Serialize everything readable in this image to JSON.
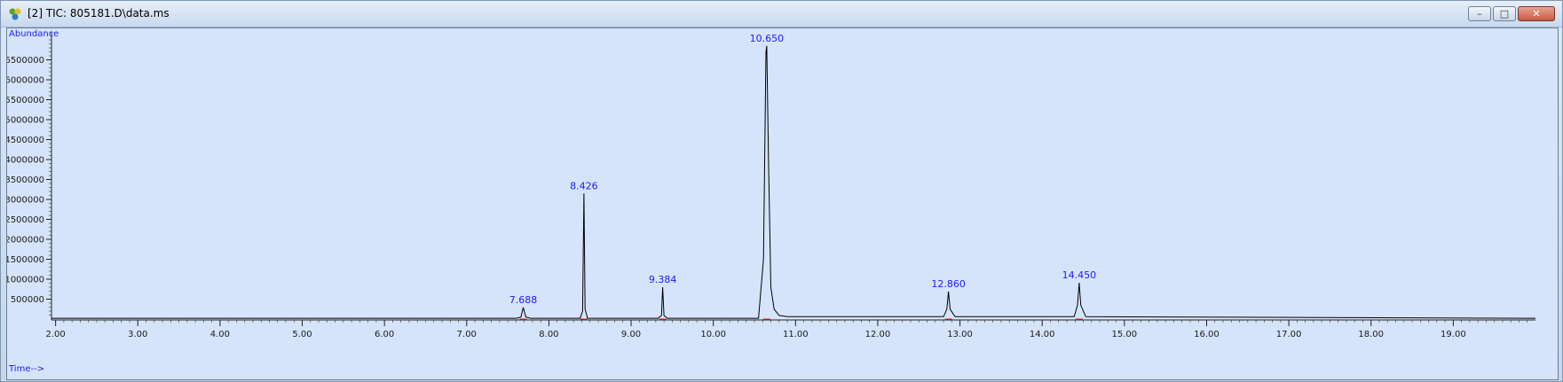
{
  "window": {
    "title": "[2] TIC: 805181.D\\data.ms",
    "buttons": {
      "minimize": "–",
      "maximize": "□",
      "close": "✕"
    }
  },
  "chart_data": {
    "type": "line",
    "title": "",
    "xlabel": "Time-->",
    "ylabel": "Abundance",
    "xlim": [
      1.95,
      20.0
    ],
    "ylim": [
      0,
      7200000
    ],
    "x_ticks": [
      {
        "value": 2.0,
        "label": "2.00"
      },
      {
        "value": 3.0,
        "label": "3.00"
      },
      {
        "value": 4.0,
        "label": "4.00"
      },
      {
        "value": 5.0,
        "label": "5.00"
      },
      {
        "value": 6.0,
        "label": "6.00"
      },
      {
        "value": 7.0,
        "label": "7.00"
      },
      {
        "value": 8.0,
        "label": "8.00"
      },
      {
        "value": 9.0,
        "label": "9.00"
      },
      {
        "value": 10.0,
        "label": "10.00"
      },
      {
        "value": 11.0,
        "label": "11.00"
      },
      {
        "value": 12.0,
        "label": "12.00"
      },
      {
        "value": 13.0,
        "label": "13.00"
      },
      {
        "value": 14.0,
        "label": "14.00"
      },
      {
        "value": 15.0,
        "label": "15.00"
      },
      {
        "value": 16.0,
        "label": "16.00"
      },
      {
        "value": 17.0,
        "label": "17.00"
      },
      {
        "value": 18.0,
        "label": "18.00"
      },
      {
        "value": 19.0,
        "label": "19.00"
      }
    ],
    "y_ticks": [
      {
        "value": 500000,
        "label": "500000"
      },
      {
        "value": 1000000,
        "label": "1000000"
      },
      {
        "value": 1500000,
        "label": "1500000"
      },
      {
        "value": 2000000,
        "label": "2000000"
      },
      {
        "value": 2500000,
        "label": "2500000"
      },
      {
        "value": 3000000,
        "label": "3000000"
      },
      {
        "value": 3500000,
        "label": "3500000"
      },
      {
        "value": 4000000,
        "label": "4000000"
      },
      {
        "value": 4500000,
        "label": "4500000"
      },
      {
        "value": 5000000,
        "label": "5000000"
      },
      {
        "value": 5500000,
        "label": "5500000"
      },
      {
        "value": 6000000,
        "label": "6000000"
      },
      {
        "value": 6500000,
        "label": "6500000"
      }
    ],
    "series": [
      {
        "color": "#000000",
        "x": [
          1.95,
          7.6,
          7.66,
          7.688,
          7.72,
          7.78,
          8.38,
          8.41,
          8.426,
          8.44,
          8.47,
          9.33,
          9.37,
          9.384,
          9.4,
          9.44,
          10.55,
          10.61,
          10.64,
          10.65,
          10.67,
          10.7,
          10.74,
          10.8,
          10.9,
          12.8,
          12.84,
          12.86,
          12.88,
          12.94,
          14.39,
          14.43,
          14.45,
          14.47,
          14.53,
          20.0
        ],
        "y": [
          20000,
          20000,
          50000,
          290000,
          50000,
          20000,
          20000,
          200000,
          3150000,
          250000,
          20000,
          20000,
          90000,
          800000,
          90000,
          20000,
          20000,
          1500000,
          6700000,
          6850000,
          4200000,
          800000,
          250000,
          90000,
          60000,
          60000,
          250000,
          690000,
          250000,
          60000,
          60000,
          350000,
          910000,
          350000,
          60000,
          20000
        ]
      }
    ],
    "peaks": [
      {
        "rt": 7.688,
        "label": "7.688",
        "height": 290000
      },
      {
        "rt": 8.426,
        "label": "8.426",
        "height": 3150000
      },
      {
        "rt": 9.384,
        "label": "9.384",
        "height": 800000
      },
      {
        "rt": 10.65,
        "label": "10.650",
        "height": 6850000
      },
      {
        "rt": 12.86,
        "label": "12.860",
        "height": 690000
      },
      {
        "rt": 14.45,
        "label": "14.450",
        "height": 910000
      }
    ],
    "peak_label_color": "#1a1aff",
    "baseline_color": "#e02020",
    "background": "#d6e4fb"
  }
}
